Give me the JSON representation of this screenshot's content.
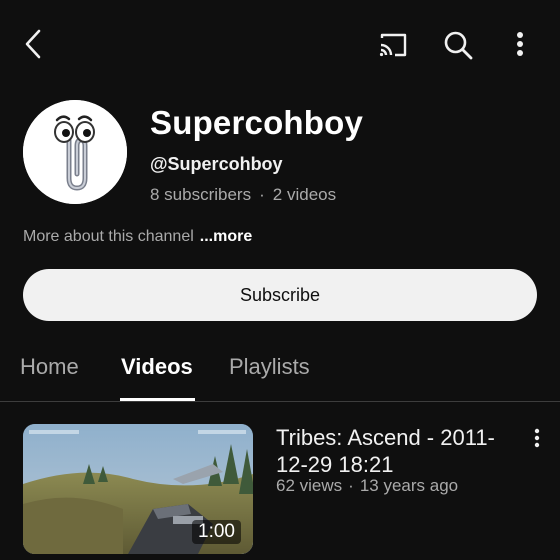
{
  "topbar": {
    "back_icon": "chevron-left-icon",
    "cast_icon": "cast-icon",
    "search_icon": "search-icon",
    "more_icon": "more-vertical-icon"
  },
  "channel": {
    "name": "Supercohboy",
    "handle": "@Supercohboy",
    "subscribers": "8 subscribers",
    "separator": "·",
    "videos": "2 videos",
    "about_text": "More about this channel",
    "about_more": "...more",
    "subscribe_label": "Subscribe"
  },
  "tabs": [
    {
      "label": "Home",
      "active": false
    },
    {
      "label": "Videos",
      "active": true
    },
    {
      "label": "Playlists",
      "active": false
    }
  ],
  "videos": [
    {
      "title": "Tribes: Ascend - 2011-12-29 18:21",
      "views": "62 views",
      "separator": "·",
      "age": "13 years ago",
      "duration": "1:00"
    }
  ],
  "colors": {
    "background": "#0f0f0f",
    "text_primary": "#f1f1f1",
    "text_secondary": "#aaaaaa",
    "subscribe_bg": "#f1f1f1"
  }
}
